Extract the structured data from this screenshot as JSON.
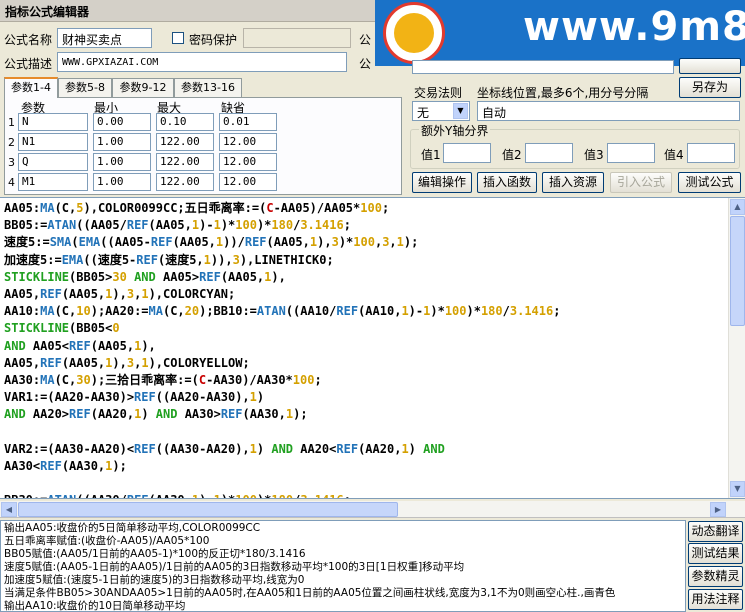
{
  "window": {
    "title": "指标公式编辑器"
  },
  "form": {
    "name_label": "公式名称",
    "name_value": "财神买卖点",
    "password_label": "密码保护",
    "desc_label": "公式描述",
    "desc_value": "WWW.GPXIAZAI.COM",
    "right_label_1": "公",
    "right_label_2": "公"
  },
  "tabs": [
    "参数1-4",
    "参数5-8",
    "参数9-12",
    "参数13-16"
  ],
  "params": {
    "headers": [
      "参数",
      "最小",
      "最大",
      "缺省"
    ],
    "rows": [
      {
        "no": "1",
        "name": "N",
        "min": "0.00",
        "max": "0.10",
        "def": "0.01"
      },
      {
        "no": "2",
        "name": "N1",
        "min": "1.00",
        "max": "122.00",
        "def": "12.00"
      },
      {
        "no": "3",
        "name": "Q",
        "min": "1.00",
        "max": "122.00",
        "def": "12.00"
      },
      {
        "no": "4",
        "name": "M1",
        "min": "1.00",
        "max": "122.00",
        "def": "12.00"
      }
    ]
  },
  "trade": {
    "rule_label": "交易法则",
    "coord_label": "坐标线位置,最多6个,用分号分隔",
    "save_as": "另存为",
    "rule_value": "无",
    "coord_value": "自动",
    "extra_axis_label": "额外Y轴分界",
    "value_labels": [
      "值1",
      "值2",
      "值3",
      "值4"
    ]
  },
  "actions": {
    "edit": "编辑操作",
    "insert_fn": "插入函数",
    "insert_res": "插入资源",
    "import": "引入公式",
    "test": "测试公式"
  },
  "side_buttons": [
    "动态翻译",
    "测试结果",
    "参数精灵",
    "用法注释"
  ],
  "output_lines": [
    "输出AA05:收盘价的5日简单移动平均,COLOR0099CC",
    "五日乖离率赋值:(收盘价-AA05)/AA05*100",
    "BB05赋值:(AA05/1日前的AA05-1)*100的反正切*180/3.1416",
    "速度5赋值:(AA05-1日前的AA05)/1日前的AA05的3日指数移动平均*100的3日[1日权重]移动平均",
    "加速度5赋值:(速度5-1日前的速度5)的3日指数移动平均,线宽为0",
    "当满足条件BB05>30ANDAA05>1日前的AA05时,在AA05和1日前的AA05位置之间画柱状线,宽度为3,1不为0则画空心柱.,画青色",
    "输出AA10:收盘价的10日简单移动平均"
  ],
  "watermark": {
    "text": "www.9m8.cn"
  }
}
